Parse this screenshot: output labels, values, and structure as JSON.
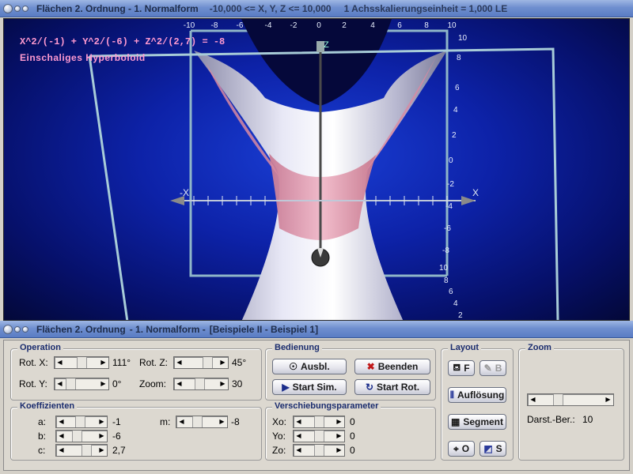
{
  "window": {
    "title": "Flächen 2. Ordnung - 1. Normalform",
    "range": "-10,000 <= X, Y, Z <= 10,000",
    "scale": "1 Achsskalierungseinheit = 1,000 LE"
  },
  "view": {
    "formula": "X^2/(-1) + Y^2/(-6) + Z^2/(2,7) = -8",
    "surface_name": "Einschaliges Hyperboloid",
    "top_ticks": [
      "-10",
      "-8",
      "-6",
      "-4",
      "-2",
      "0",
      "2",
      "4",
      "6",
      "8",
      "10"
    ],
    "right_ticks": [
      "10",
      "8",
      "6",
      "4",
      "2",
      "0",
      "-2",
      "-4",
      "-6",
      "-8",
      "10",
      "8",
      "6",
      "4",
      "2"
    ],
    "axis_labels": {
      "x_neg": "-X",
      "x_pos": "X",
      "z": "Z"
    },
    "colors": {
      "surface": "#d8d8ec",
      "band": "#e89ab0",
      "frame": "#a8c8d8"
    }
  },
  "bar2": {
    "title": "Flächen 2. Ordnung",
    "subtitle": "- 1. Normalform -",
    "example": "[Beispiele II - Beispiel 1]"
  },
  "operation": {
    "legend": "Operation",
    "rot_x_label": "Rot. X:",
    "rot_x_value": "111°",
    "rot_y_label": "Rot. Y:",
    "rot_y_value": "0°",
    "rot_z_label": "Rot. Z:",
    "rot_z_value": "45°",
    "zoom_label": "Zoom:",
    "zoom_value": "30"
  },
  "koeffizienten": {
    "legend": "Koeffizienten",
    "a_label": "a:",
    "a_value": "-1",
    "b_label": "b:",
    "b_value": "-6",
    "c_label": "c:",
    "c_value": "2,7",
    "m_label": "m:",
    "m_value": "-8"
  },
  "bedienung": {
    "legend": "Bedienung",
    "ausbl": "Ausbl.",
    "beenden": "Beenden",
    "start_sim": "Start Sim.",
    "start_rot": "Start Rot."
  },
  "verschiebung": {
    "legend": "Verschiebungsparameter",
    "xo_label": "Xo:",
    "xo_value": "0",
    "yo_label": "Yo:",
    "yo_value": "0",
    "zo_label": "Zo:",
    "zo_value": "0"
  },
  "layout": {
    "legend": "Layout",
    "f_label": "F",
    "b_label": "B",
    "aufloesung": "Auflösung",
    "segment": "Segment",
    "o_label": "O",
    "s_label": "S"
  },
  "zoom": {
    "legend": "Zoom",
    "darst_label": "Darst.-Ber.:",
    "darst_value": "10"
  }
}
